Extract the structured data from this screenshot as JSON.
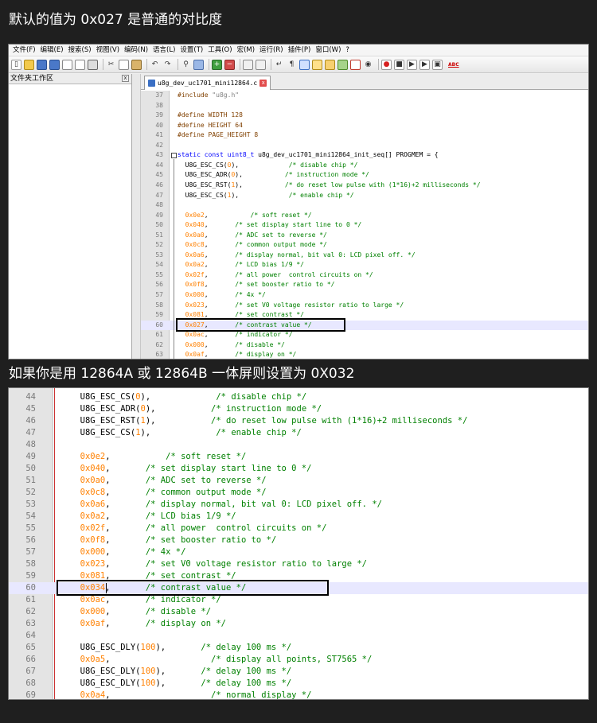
{
  "captions": {
    "top": "默认的值为 0x027 是普通的对比度",
    "middle": "如果你是用 12864A 或 12864B 一体屏则设置为 0X032"
  },
  "window": {
    "menu": [
      "文件(F)",
      "编辑(E)",
      "搜索(S)",
      "视图(V)",
      "编码(N)",
      "语言(L)",
      "设置(T)",
      "工具(O)",
      "宏(M)",
      "运行(R)",
      "插件(P)",
      "窗口(W)",
      "?"
    ],
    "toolbar_icons": [
      "new-file-icon",
      "open-file-icon",
      "save-icon",
      "save-all-icon",
      "close-icon",
      "close-all-icon",
      "print-icon",
      "cut-icon",
      "copy-icon",
      "paste-icon",
      "undo-icon",
      "redo-icon",
      "find-icon",
      "replace-icon",
      "zoom-in-icon",
      "zoom-out-icon",
      "sync-v-icon",
      "sync-h-icon",
      "wrap-icon",
      "all-chars-icon",
      "indent-guide-icon",
      "lang-icon",
      "doc-map-icon",
      "function-list-icon",
      "folder-workspace-icon",
      "monitor-icon",
      "record-macro-icon",
      "stop-macro-icon",
      "play-macro-icon",
      "run-macro-icon",
      "save-macro-icon",
      "spell-check-icon"
    ],
    "toolbar_spellcheck_label": "ABC",
    "folder_panel_title": "文件夹工作区",
    "folder_panel_close": "x",
    "tab_label": "u8g_dev_uc1701_mini12864.c",
    "tab_close": "x"
  },
  "colors": {
    "keyword": "#0000ff",
    "preprocessor": "#804000",
    "number": "#ff8000",
    "comment": "#008000",
    "string": "#808080",
    "identifier": "#000000"
  },
  "code_top": [
    {
      "n": "37",
      "s": [
        [
          "pp",
          "#include "
        ],
        [
          "str",
          "\"u8g.h\""
        ]
      ]
    },
    {
      "n": "38",
      "s": []
    },
    {
      "n": "39",
      "s": [
        [
          "pp",
          "#define WIDTH 128"
        ]
      ]
    },
    {
      "n": "40",
      "s": [
        [
          "pp",
          "#define HEIGHT 64"
        ]
      ]
    },
    {
      "n": "41",
      "s": [
        [
          "pp",
          "#define PAGE_HEIGHT 8"
        ]
      ]
    },
    {
      "n": "42",
      "s": []
    },
    {
      "n": "43",
      "s": [
        [
          "kw",
          "static const "
        ],
        [
          "kw",
          "uint8_t "
        ],
        [
          "id",
          "u8g_dev_uc1701_mini12864_init_seq[] PROGMEM = {"
        ]
      ]
    },
    {
      "n": "44",
      "s": [
        [
          "id",
          "  U8G_ESC_CS("
        ],
        [
          "num",
          "0"
        ],
        [
          "id",
          "),"
        ],
        [
          "cm",
          "             /* disable chip */"
        ]
      ]
    },
    {
      "n": "45",
      "s": [
        [
          "id",
          "  U8G_ESC_ADR("
        ],
        [
          "num",
          "0"
        ],
        [
          "id",
          "),"
        ],
        [
          "cm",
          "           /* instruction mode */"
        ]
      ]
    },
    {
      "n": "46",
      "s": [
        [
          "id",
          "  U8G_ESC_RST("
        ],
        [
          "num",
          "1"
        ],
        [
          "id",
          "),"
        ],
        [
          "cm",
          "           /* do reset low pulse with (1*16)+2 milliseconds */"
        ]
      ]
    },
    {
      "n": "47",
      "s": [
        [
          "id",
          "  U8G_ESC_CS("
        ],
        [
          "num",
          "1"
        ],
        [
          "id",
          "),"
        ],
        [
          "cm",
          "             /* enable chip */"
        ]
      ]
    },
    {
      "n": "48",
      "s": []
    },
    {
      "n": "49",
      "s": [
        [
          "num",
          "  0x0e2"
        ],
        [
          "id",
          ","
        ],
        [
          "cm",
          "           /* soft reset */"
        ]
      ]
    },
    {
      "n": "50",
      "s": [
        [
          "num",
          "  0x040"
        ],
        [
          "id",
          ","
        ],
        [
          "cm",
          "       /* set display start line to 0 */"
        ]
      ]
    },
    {
      "n": "51",
      "s": [
        [
          "num",
          "  0x0a0"
        ],
        [
          "id",
          ","
        ],
        [
          "cm",
          "       /* ADC set to reverse */"
        ]
      ]
    },
    {
      "n": "52",
      "s": [
        [
          "num",
          "  0x0c8"
        ],
        [
          "id",
          ","
        ],
        [
          "cm",
          "       /* common output mode */"
        ]
      ]
    },
    {
      "n": "53",
      "s": [
        [
          "num",
          "  0x0a6"
        ],
        [
          "id",
          ","
        ],
        [
          "cm",
          "       /* display normal, bit val 0: LCD pixel off. */"
        ]
      ]
    },
    {
      "n": "54",
      "s": [
        [
          "num",
          "  0x0a2"
        ],
        [
          "id",
          ","
        ],
        [
          "cm",
          "       /* LCD bias 1/9 */"
        ]
      ]
    },
    {
      "n": "55",
      "s": [
        [
          "num",
          "  0x02f"
        ],
        [
          "id",
          ","
        ],
        [
          "cm",
          "       /* all power  control circuits on */"
        ]
      ]
    },
    {
      "n": "56",
      "s": [
        [
          "num",
          "  0x0f8"
        ],
        [
          "id",
          ","
        ],
        [
          "cm",
          "       /* set booster ratio to */"
        ]
      ]
    },
    {
      "n": "57",
      "s": [
        [
          "num",
          "  0x000"
        ],
        [
          "id",
          ","
        ],
        [
          "cm",
          "       /* 4x */"
        ]
      ]
    },
    {
      "n": "58",
      "s": [
        [
          "num",
          "  0x023"
        ],
        [
          "id",
          ","
        ],
        [
          "cm",
          "       /* set V0 voltage resistor ratio to large */"
        ]
      ]
    },
    {
      "n": "59",
      "s": [
        [
          "num",
          "  0x081"
        ],
        [
          "id",
          ","
        ],
        [
          "cm",
          "       /* set contrast */"
        ]
      ]
    },
    {
      "n": "60",
      "s": [
        [
          "num",
          "  0x027"
        ],
        [
          "id",
          ","
        ],
        [
          "cm",
          "       /* contrast value */"
        ]
      ]
    },
    {
      "n": "61",
      "s": [
        [
          "num",
          "  0x0ac"
        ],
        [
          "id",
          ","
        ],
        [
          "cm",
          "       /* indicator */"
        ]
      ]
    },
    {
      "n": "62",
      "s": [
        [
          "num",
          "  0x000"
        ],
        [
          "id",
          ","
        ],
        [
          "cm",
          "       /* disable */"
        ]
      ]
    },
    {
      "n": "63",
      "s": [
        [
          "num",
          "  0x0af"
        ],
        [
          "id",
          ","
        ],
        [
          "cm",
          "       /* display on */"
        ]
      ]
    }
  ],
  "code_bottom": [
    {
      "n": "44",
      "s": [
        [
          "id",
          "  U8G_ESC_CS("
        ],
        [
          "num",
          "0"
        ],
        [
          "id",
          "),"
        ],
        [
          "cm",
          "             /* disable chip */"
        ]
      ]
    },
    {
      "n": "45",
      "s": [
        [
          "id",
          "  U8G_ESC_ADR("
        ],
        [
          "num",
          "0"
        ],
        [
          "id",
          "),"
        ],
        [
          "cm",
          "           /* instruction mode */"
        ]
      ]
    },
    {
      "n": "46",
      "s": [
        [
          "id",
          "  U8G_ESC_RST("
        ],
        [
          "num",
          "1"
        ],
        [
          "id",
          "),"
        ],
        [
          "cm",
          "           /* do reset low pulse with (1*16)+2 milliseconds */"
        ]
      ]
    },
    {
      "n": "47",
      "s": [
        [
          "id",
          "  U8G_ESC_CS("
        ],
        [
          "num",
          "1"
        ],
        [
          "id",
          "),"
        ],
        [
          "cm",
          "             /* enable chip */"
        ]
      ]
    },
    {
      "n": "48",
      "s": []
    },
    {
      "n": "49",
      "s": [
        [
          "num",
          "  0x0e2"
        ],
        [
          "id",
          ","
        ],
        [
          "cm",
          "           /* soft reset */"
        ]
      ]
    },
    {
      "n": "50",
      "s": [
        [
          "num",
          "  0x040"
        ],
        [
          "id",
          ","
        ],
        [
          "cm",
          "       /* set display start line to 0 */"
        ]
      ]
    },
    {
      "n": "51",
      "s": [
        [
          "num",
          "  0x0a0"
        ],
        [
          "id",
          ","
        ],
        [
          "cm",
          "       /* ADC set to reverse */"
        ]
      ]
    },
    {
      "n": "52",
      "s": [
        [
          "num",
          "  0x0c8"
        ],
        [
          "id",
          ","
        ],
        [
          "cm",
          "       /* common output mode */"
        ]
      ]
    },
    {
      "n": "53",
      "s": [
        [
          "num",
          "  0x0a6"
        ],
        [
          "id",
          ","
        ],
        [
          "cm",
          "       /* display normal, bit val 0: LCD pixel off. */"
        ]
      ]
    },
    {
      "n": "54",
      "s": [
        [
          "num",
          "  0x0a2"
        ],
        [
          "id",
          ","
        ],
        [
          "cm",
          "       /* LCD bias 1/9 */"
        ]
      ]
    },
    {
      "n": "55",
      "s": [
        [
          "num",
          "  0x02f"
        ],
        [
          "id",
          ","
        ],
        [
          "cm",
          "       /* all power  control circuits on */"
        ]
      ]
    },
    {
      "n": "56",
      "s": [
        [
          "num",
          "  0x0f8"
        ],
        [
          "id",
          ","
        ],
        [
          "cm",
          "       /* set booster ratio to */"
        ]
      ]
    },
    {
      "n": "57",
      "s": [
        [
          "num",
          "  0x000"
        ],
        [
          "id",
          ","
        ],
        [
          "cm",
          "       /* 4x */"
        ]
      ]
    },
    {
      "n": "58",
      "s": [
        [
          "num",
          "  0x023"
        ],
        [
          "id",
          ","
        ],
        [
          "cm",
          "       /* set V0 voltage resistor ratio to large */"
        ]
      ]
    },
    {
      "n": "59",
      "s": [
        [
          "num",
          "  0x081"
        ],
        [
          "id",
          ","
        ],
        [
          "cm",
          "       /* set contrast */"
        ]
      ]
    },
    {
      "n": "60",
      "s": [
        [
          "num",
          "  0x034"
        ],
        [
          "id",
          ","
        ],
        [
          "cm",
          "       /* contrast value */"
        ]
      ]
    },
    {
      "n": "61",
      "s": [
        [
          "num",
          "  0x0ac"
        ],
        [
          "id",
          ","
        ],
        [
          "cm",
          "       /* indicator */"
        ]
      ]
    },
    {
      "n": "62",
      "s": [
        [
          "num",
          "  0x000"
        ],
        [
          "id",
          ","
        ],
        [
          "cm",
          "       /* disable */"
        ]
      ]
    },
    {
      "n": "63",
      "s": [
        [
          "num",
          "  0x0af"
        ],
        [
          "id",
          ","
        ],
        [
          "cm",
          "       /* display on */"
        ]
      ]
    },
    {
      "n": "64",
      "s": []
    },
    {
      "n": "65",
      "s": [
        [
          "id",
          "  U8G_ESC_DLY("
        ],
        [
          "num",
          "100"
        ],
        [
          "id",
          "),"
        ],
        [
          "cm",
          "       /* delay 100 ms */"
        ]
      ]
    },
    {
      "n": "66",
      "s": [
        [
          "num",
          "  0x0a5"
        ],
        [
          "id",
          ","
        ],
        [
          "cm",
          "                    /* display all points, ST7565 */"
        ]
      ]
    },
    {
      "n": "67",
      "s": [
        [
          "id",
          "  U8G_ESC_DLY("
        ],
        [
          "num",
          "100"
        ],
        [
          "id",
          "),"
        ],
        [
          "cm",
          "       /* delay 100 ms */"
        ]
      ]
    },
    {
      "n": "68",
      "s": [
        [
          "id",
          "  U8G_ESC_DLY("
        ],
        [
          "num",
          "100"
        ],
        [
          "id",
          "),"
        ],
        [
          "cm",
          "       /* delay 100 ms */"
        ]
      ]
    },
    {
      "n": "69",
      "s": [
        [
          "num",
          "  0x0a4"
        ],
        [
          "id",
          ","
        ],
        [
          "cm",
          "                    /* normal display */"
        ]
      ]
    }
  ]
}
